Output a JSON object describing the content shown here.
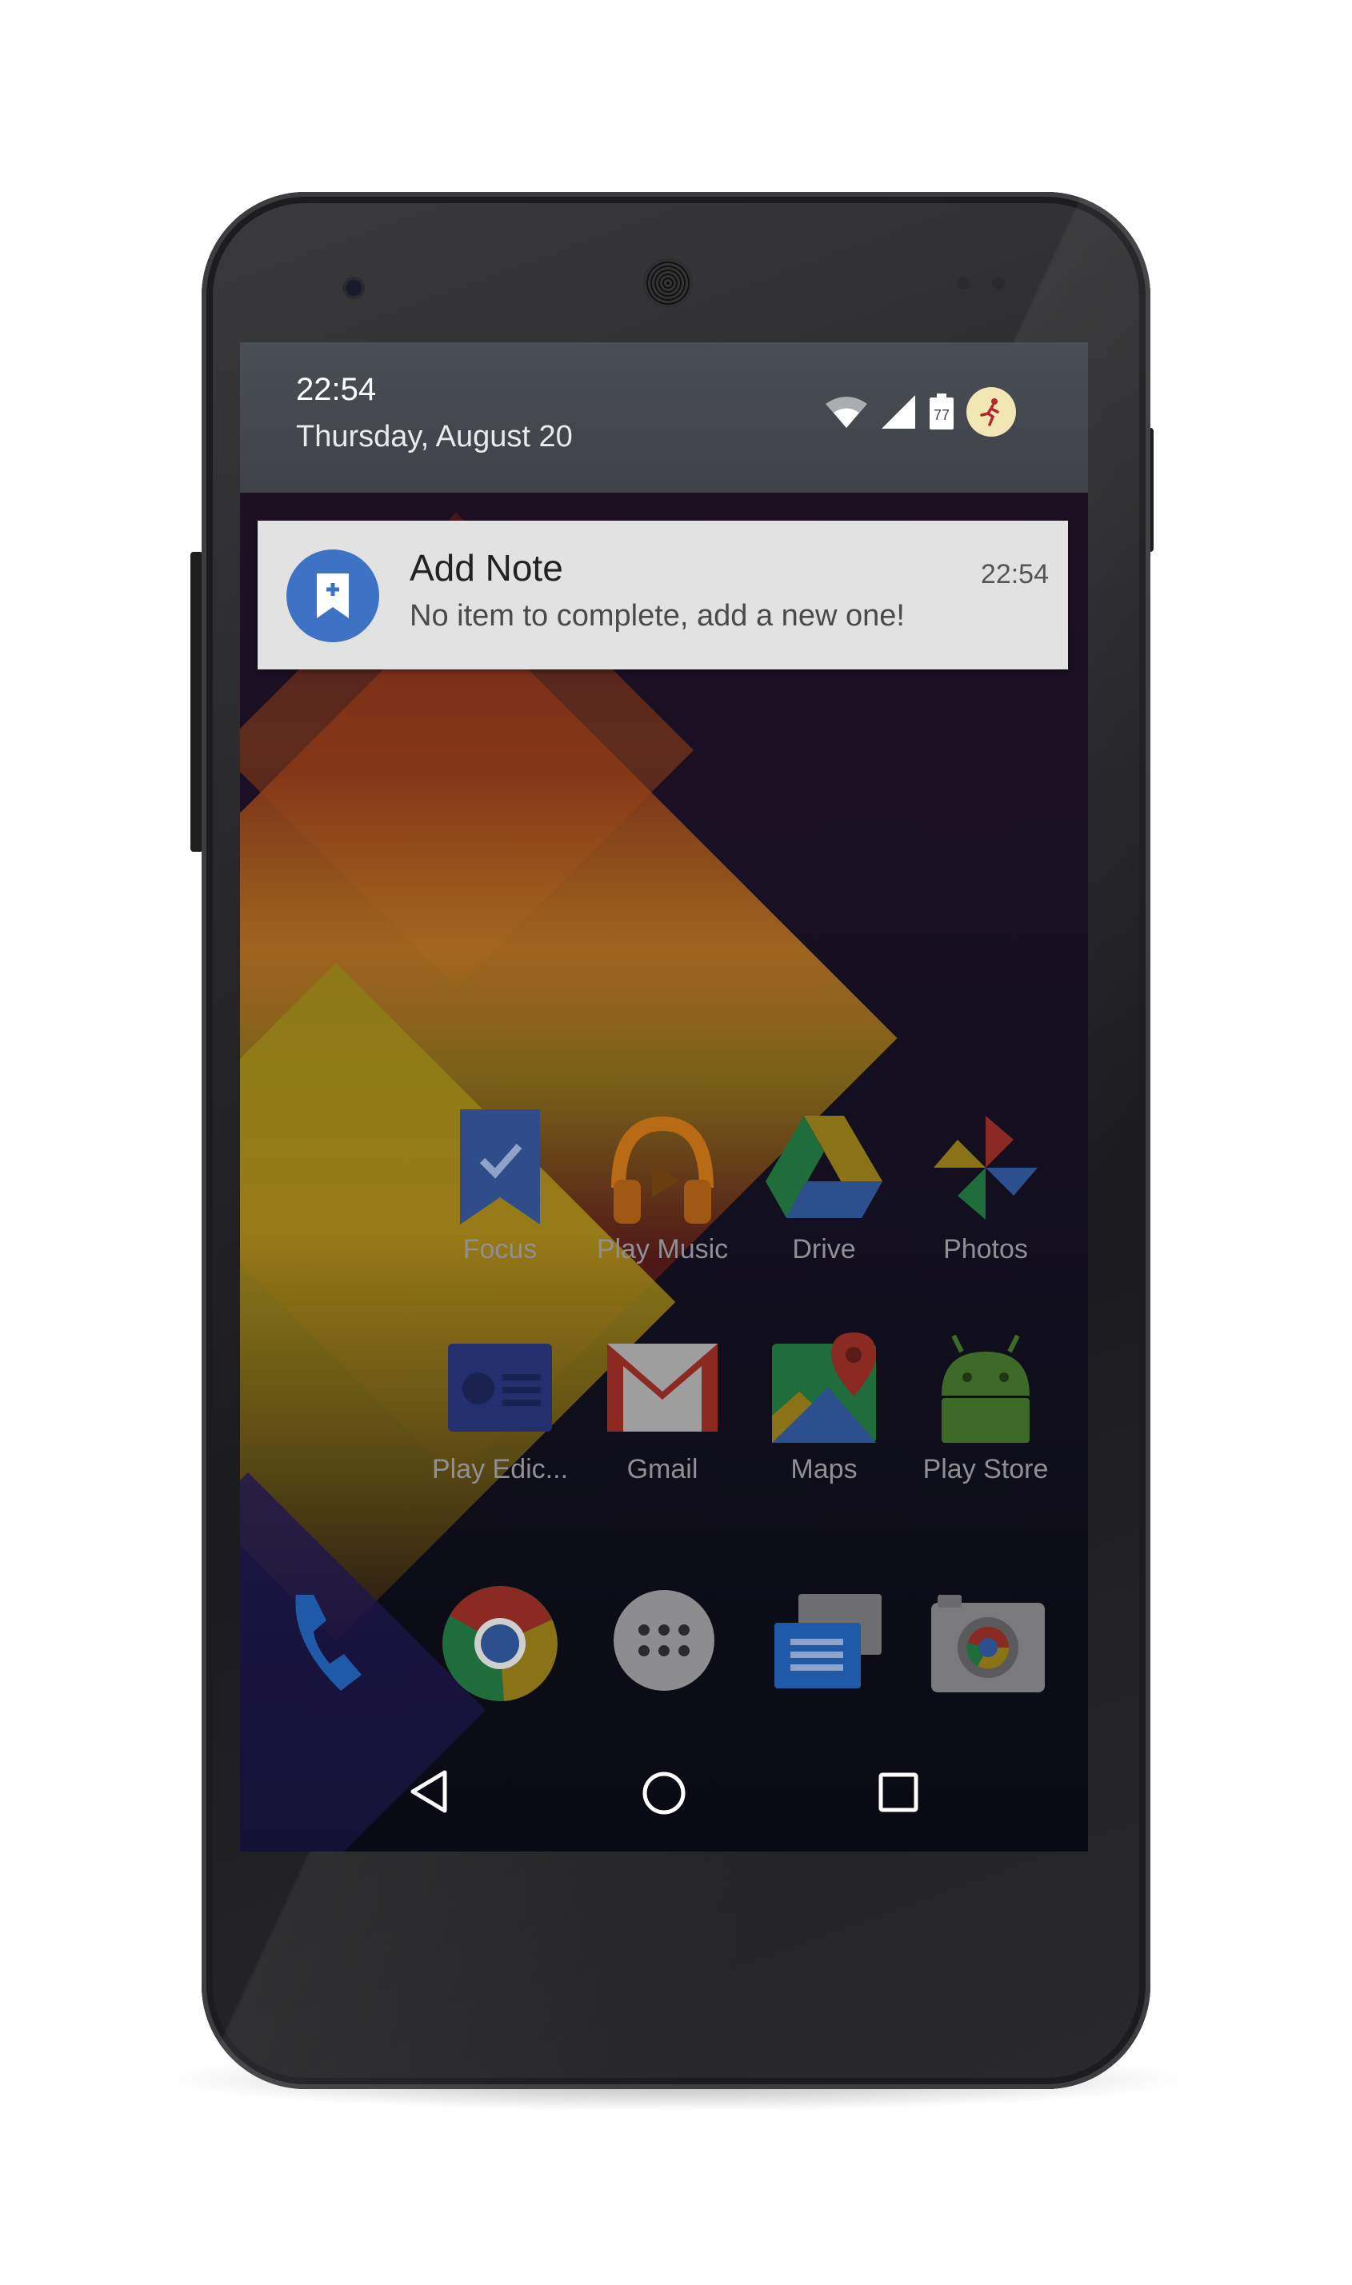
{
  "status_bar": {
    "time": "22:54",
    "date": "Thursday, August 20",
    "battery_level": "77"
  },
  "notification": {
    "title": "Add Note",
    "body": "No item to complete, add a new one!",
    "time": "22:54"
  },
  "apps": [
    {
      "label": "Focus",
      "icon": "bookmark-check-icon"
    },
    {
      "label": "Play Music",
      "icon": "headphones-icon"
    },
    {
      "label": "Drive",
      "icon": "drive-triangle-icon"
    },
    {
      "label": "Photos",
      "icon": "pinwheel-icon"
    },
    {
      "label": "Play Edic...",
      "icon": "newsstand-icon"
    },
    {
      "label": "Gmail",
      "icon": "envelope-icon"
    },
    {
      "label": "Maps",
      "icon": "map-pin-icon"
    },
    {
      "label": "Play Store",
      "icon": "android-icon"
    }
  ],
  "dock": [
    {
      "icon": "phone-icon"
    },
    {
      "icon": "chrome-icon"
    },
    {
      "icon": "app-drawer-icon"
    },
    {
      "icon": "messenger-icon"
    },
    {
      "icon": "camera-icon"
    }
  ],
  "nav": {
    "back": "back-icon",
    "home": "home-icon",
    "recents": "recents-icon"
  }
}
